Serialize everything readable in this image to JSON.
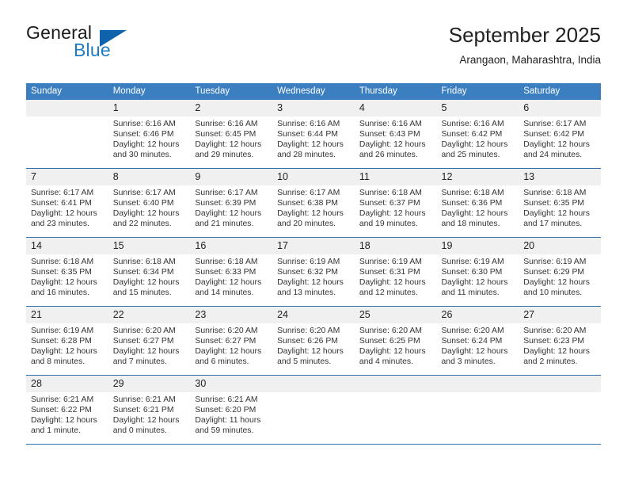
{
  "brand": {
    "name_top": "General",
    "name_bottom": "Blue",
    "triangle_color": "#0f63ad",
    "blue_text_color": "#1f7ac4"
  },
  "header": {
    "title": "September 2025",
    "subtitle": "Arangaon, Maharashtra, India"
  },
  "calendar": {
    "header_bg": "#3c7fc1",
    "daynum_bg": "#f0f0f0",
    "separator_color": "#2f6fad",
    "weekday_headers": [
      "Sunday",
      "Monday",
      "Tuesday",
      "Wednesday",
      "Thursday",
      "Friday",
      "Saturday"
    ],
    "weeks": [
      [
        {
          "day": "",
          "sunrise": "",
          "sunset": "",
          "daylight_line1": "",
          "daylight_line2": ""
        },
        {
          "day": "1",
          "sunrise": "Sunrise: 6:16 AM",
          "sunset": "Sunset: 6:46 PM",
          "daylight_line1": "Daylight: 12 hours",
          "daylight_line2": "and 30 minutes."
        },
        {
          "day": "2",
          "sunrise": "Sunrise: 6:16 AM",
          "sunset": "Sunset: 6:45 PM",
          "daylight_line1": "Daylight: 12 hours",
          "daylight_line2": "and 29 minutes."
        },
        {
          "day": "3",
          "sunrise": "Sunrise: 6:16 AM",
          "sunset": "Sunset: 6:44 PM",
          "daylight_line1": "Daylight: 12 hours",
          "daylight_line2": "and 28 minutes."
        },
        {
          "day": "4",
          "sunrise": "Sunrise: 6:16 AM",
          "sunset": "Sunset: 6:43 PM",
          "daylight_line1": "Daylight: 12 hours",
          "daylight_line2": "and 26 minutes."
        },
        {
          "day": "5",
          "sunrise": "Sunrise: 6:16 AM",
          "sunset": "Sunset: 6:42 PM",
          "daylight_line1": "Daylight: 12 hours",
          "daylight_line2": "and 25 minutes."
        },
        {
          "day": "6",
          "sunrise": "Sunrise: 6:17 AM",
          "sunset": "Sunset: 6:42 PM",
          "daylight_line1": "Daylight: 12 hours",
          "daylight_line2": "and 24 minutes."
        }
      ],
      [
        {
          "day": "7",
          "sunrise": "Sunrise: 6:17 AM",
          "sunset": "Sunset: 6:41 PM",
          "daylight_line1": "Daylight: 12 hours",
          "daylight_line2": "and 23 minutes."
        },
        {
          "day": "8",
          "sunrise": "Sunrise: 6:17 AM",
          "sunset": "Sunset: 6:40 PM",
          "daylight_line1": "Daylight: 12 hours",
          "daylight_line2": "and 22 minutes."
        },
        {
          "day": "9",
          "sunrise": "Sunrise: 6:17 AM",
          "sunset": "Sunset: 6:39 PM",
          "daylight_line1": "Daylight: 12 hours",
          "daylight_line2": "and 21 minutes."
        },
        {
          "day": "10",
          "sunrise": "Sunrise: 6:17 AM",
          "sunset": "Sunset: 6:38 PM",
          "daylight_line1": "Daylight: 12 hours",
          "daylight_line2": "and 20 minutes."
        },
        {
          "day": "11",
          "sunrise": "Sunrise: 6:18 AM",
          "sunset": "Sunset: 6:37 PM",
          "daylight_line1": "Daylight: 12 hours",
          "daylight_line2": "and 19 minutes."
        },
        {
          "day": "12",
          "sunrise": "Sunrise: 6:18 AM",
          "sunset": "Sunset: 6:36 PM",
          "daylight_line1": "Daylight: 12 hours",
          "daylight_line2": "and 18 minutes."
        },
        {
          "day": "13",
          "sunrise": "Sunrise: 6:18 AM",
          "sunset": "Sunset: 6:35 PM",
          "daylight_line1": "Daylight: 12 hours",
          "daylight_line2": "and 17 minutes."
        }
      ],
      [
        {
          "day": "14",
          "sunrise": "Sunrise: 6:18 AM",
          "sunset": "Sunset: 6:35 PM",
          "daylight_line1": "Daylight: 12 hours",
          "daylight_line2": "and 16 minutes."
        },
        {
          "day": "15",
          "sunrise": "Sunrise: 6:18 AM",
          "sunset": "Sunset: 6:34 PM",
          "daylight_line1": "Daylight: 12 hours",
          "daylight_line2": "and 15 minutes."
        },
        {
          "day": "16",
          "sunrise": "Sunrise: 6:18 AM",
          "sunset": "Sunset: 6:33 PM",
          "daylight_line1": "Daylight: 12 hours",
          "daylight_line2": "and 14 minutes."
        },
        {
          "day": "17",
          "sunrise": "Sunrise: 6:19 AM",
          "sunset": "Sunset: 6:32 PM",
          "daylight_line1": "Daylight: 12 hours",
          "daylight_line2": "and 13 minutes."
        },
        {
          "day": "18",
          "sunrise": "Sunrise: 6:19 AM",
          "sunset": "Sunset: 6:31 PM",
          "daylight_line1": "Daylight: 12 hours",
          "daylight_line2": "and 12 minutes."
        },
        {
          "day": "19",
          "sunrise": "Sunrise: 6:19 AM",
          "sunset": "Sunset: 6:30 PM",
          "daylight_line1": "Daylight: 12 hours",
          "daylight_line2": "and 11 minutes."
        },
        {
          "day": "20",
          "sunrise": "Sunrise: 6:19 AM",
          "sunset": "Sunset: 6:29 PM",
          "daylight_line1": "Daylight: 12 hours",
          "daylight_line2": "and 10 minutes."
        }
      ],
      [
        {
          "day": "21",
          "sunrise": "Sunrise: 6:19 AM",
          "sunset": "Sunset: 6:28 PM",
          "daylight_line1": "Daylight: 12 hours",
          "daylight_line2": "and 8 minutes."
        },
        {
          "day": "22",
          "sunrise": "Sunrise: 6:20 AM",
          "sunset": "Sunset: 6:27 PM",
          "daylight_line1": "Daylight: 12 hours",
          "daylight_line2": "and 7 minutes."
        },
        {
          "day": "23",
          "sunrise": "Sunrise: 6:20 AM",
          "sunset": "Sunset: 6:27 PM",
          "daylight_line1": "Daylight: 12 hours",
          "daylight_line2": "and 6 minutes."
        },
        {
          "day": "24",
          "sunrise": "Sunrise: 6:20 AM",
          "sunset": "Sunset: 6:26 PM",
          "daylight_line1": "Daylight: 12 hours",
          "daylight_line2": "and 5 minutes."
        },
        {
          "day": "25",
          "sunrise": "Sunrise: 6:20 AM",
          "sunset": "Sunset: 6:25 PM",
          "daylight_line1": "Daylight: 12 hours",
          "daylight_line2": "and 4 minutes."
        },
        {
          "day": "26",
          "sunrise": "Sunrise: 6:20 AM",
          "sunset": "Sunset: 6:24 PM",
          "daylight_line1": "Daylight: 12 hours",
          "daylight_line2": "and 3 minutes."
        },
        {
          "day": "27",
          "sunrise": "Sunrise: 6:20 AM",
          "sunset": "Sunset: 6:23 PM",
          "daylight_line1": "Daylight: 12 hours",
          "daylight_line2": "and 2 minutes."
        }
      ],
      [
        {
          "day": "28",
          "sunrise": "Sunrise: 6:21 AM",
          "sunset": "Sunset: 6:22 PM",
          "daylight_line1": "Daylight: 12 hours",
          "daylight_line2": "and 1 minute."
        },
        {
          "day": "29",
          "sunrise": "Sunrise: 6:21 AM",
          "sunset": "Sunset: 6:21 PM",
          "daylight_line1": "Daylight: 12 hours",
          "daylight_line2": "and 0 minutes."
        },
        {
          "day": "30",
          "sunrise": "Sunrise: 6:21 AM",
          "sunset": "Sunset: 6:20 PM",
          "daylight_line1": "Daylight: 11 hours",
          "daylight_line2": "and 59 minutes."
        },
        {
          "day": "",
          "sunrise": "",
          "sunset": "",
          "daylight_line1": "",
          "daylight_line2": ""
        },
        {
          "day": "",
          "sunrise": "",
          "sunset": "",
          "daylight_line1": "",
          "daylight_line2": ""
        },
        {
          "day": "",
          "sunrise": "",
          "sunset": "",
          "daylight_line1": "",
          "daylight_line2": ""
        },
        {
          "day": "",
          "sunrise": "",
          "sunset": "",
          "daylight_line1": "",
          "daylight_line2": ""
        }
      ]
    ]
  }
}
